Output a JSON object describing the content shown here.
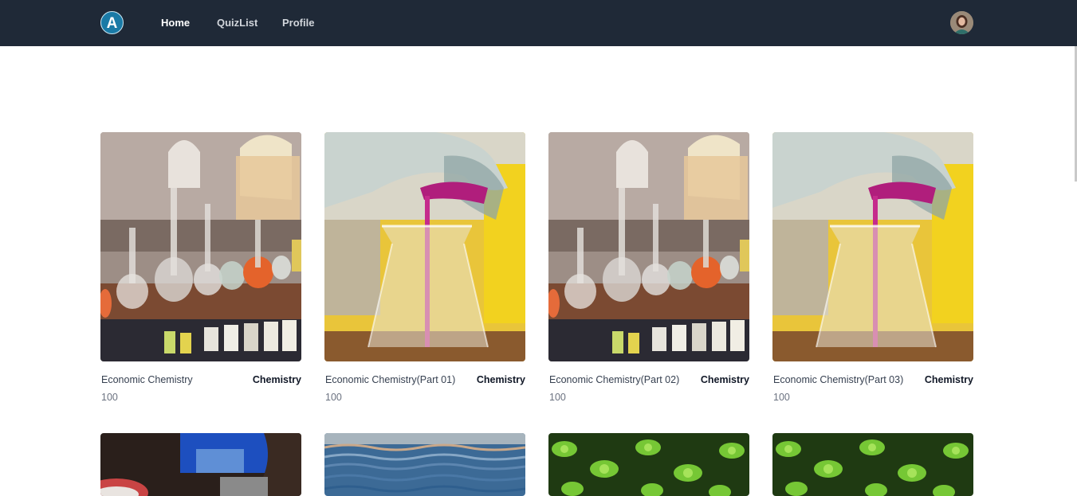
{
  "navbar": {
    "logo_letter": "A",
    "links": [
      {
        "label": "Home",
        "active": true
      },
      {
        "label": "QuizList",
        "active": false
      },
      {
        "label": "Profile",
        "active": false
      }
    ],
    "avatar_icon": "user-avatar",
    "background": "#1f2937"
  },
  "cards": [
    {
      "title": "Economic Chemistry",
      "category": "Chemistry",
      "score": "100",
      "image": "chemistry-lab-flasks"
    },
    {
      "title": "Economic Chemistry(Part 01)",
      "category": "Chemistry",
      "score": "100",
      "image": "pouring-beaker"
    },
    {
      "title": "Economic Chemistry(Part 02)",
      "category": "Chemistry",
      "score": "100",
      "image": "chemistry-lab-flasks"
    },
    {
      "title": "Economic Chemistry(Part 03)",
      "category": "Chemistry",
      "score": "100",
      "image": "pouring-beaker"
    }
  ],
  "cards_row2": [
    {
      "image": "lab-equipment-dark"
    },
    {
      "image": "water-surface"
    },
    {
      "image": "green-succulents"
    },
    {
      "image": "green-succulents"
    }
  ]
}
